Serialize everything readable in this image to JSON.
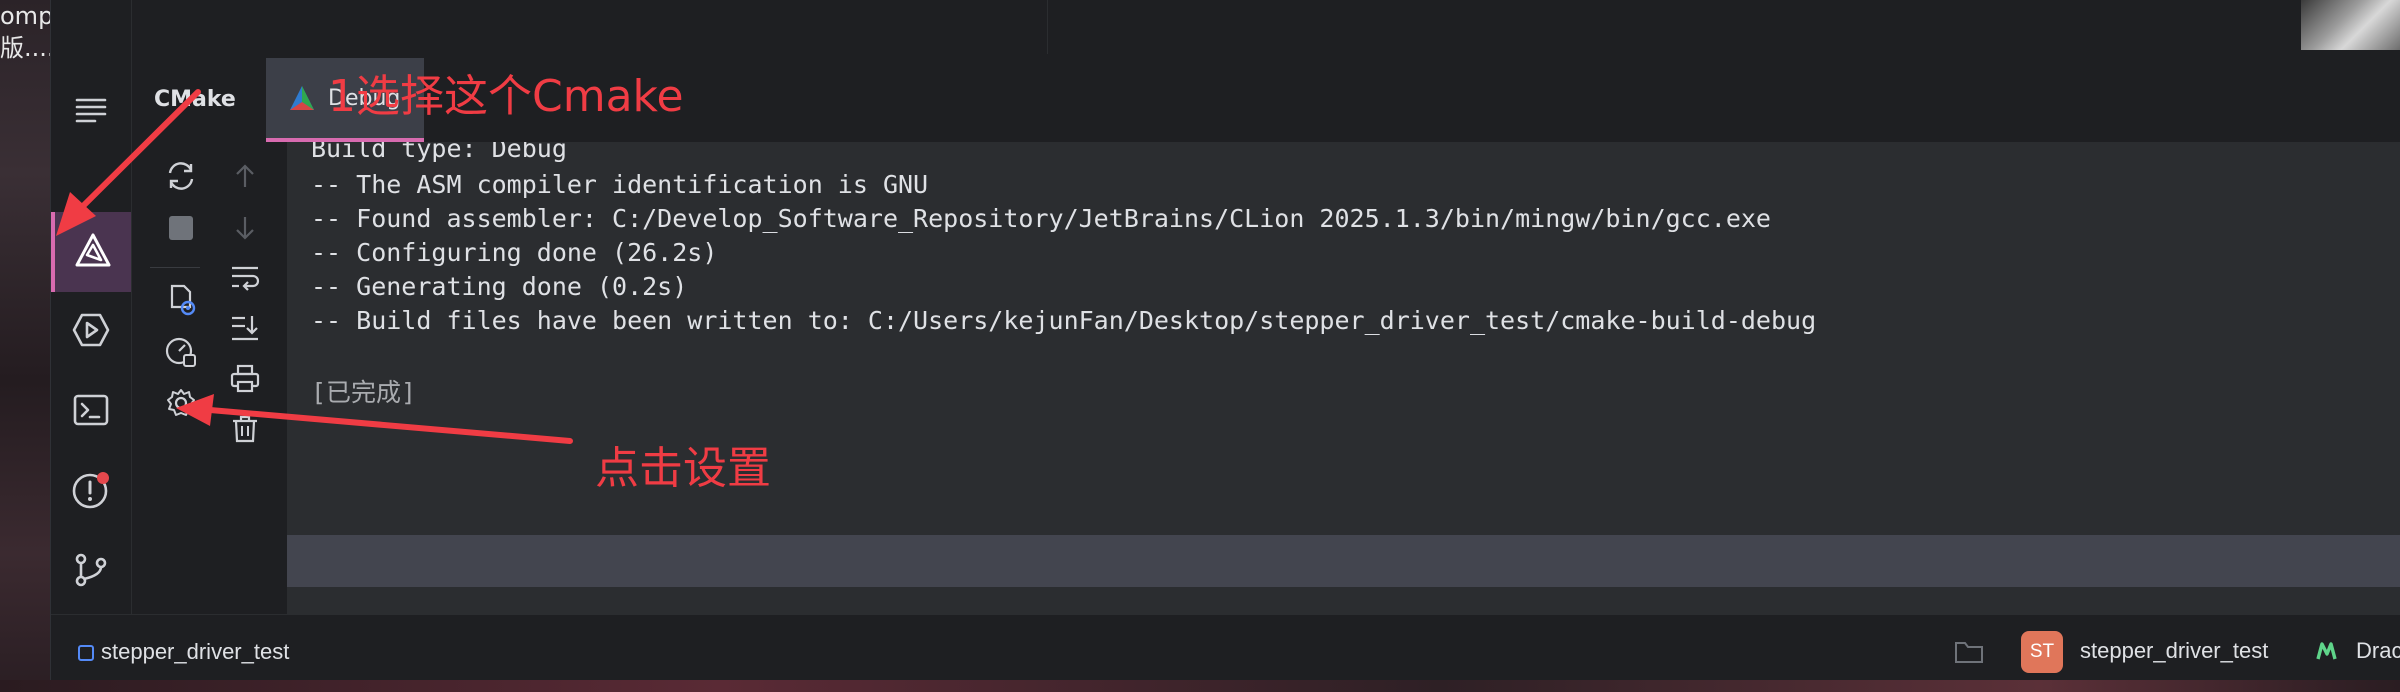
{
  "desktop": {
    "text_line1": "omp",
    "text_line2": "版...."
  },
  "tool_window": {
    "title": "CMake",
    "tab_label": "Debug",
    "console_lines": [
      "Build type: Debug",
      "-- The ASM compiler identification is GNU",
      "-- Found assembler: C:/Develop_Software_Repository/JetBrains/CLion 2025.1.3/bin/mingw/bin/gcc.exe",
      "-- Configuring done (26.2s)",
      "-- Generating done (0.2s)",
      "-- Build files have been written to: C:/Users/kejunFan/Desktop/stepper_driver_test/cmake-build-debug"
    ],
    "finished_text": "[已完成]"
  },
  "left_strip": {
    "icons": [
      "structure-icon",
      "cmake-icon",
      "run-icon",
      "terminal-icon",
      "problems-icon",
      "git-icon"
    ]
  },
  "actions": {
    "icons": [
      "reload-icon",
      "stop-icon",
      "cmake-cache-icon",
      "profile-icon",
      "settings-icon",
      "up-arrow-icon",
      "down-arrow-icon",
      "soft-wrap-icon",
      "scroll-to-end-icon",
      "print-icon",
      "trash-icon"
    ]
  },
  "status_bar": {
    "project_name": "stepper_driver_test",
    "badge_text": "ST",
    "project_name_right": "stepper_driver_test",
    "trailing_text": "Drac"
  },
  "annotations": {
    "select_cmake": "1选择这个Cmake",
    "click_settings": "点击设置"
  },
  "colors": {
    "accent": "#d86bb0",
    "annotation": "#f03c44",
    "badge": "#e0765a",
    "project_square": "#548af7",
    "vcs_icon": "#5fd48a"
  }
}
